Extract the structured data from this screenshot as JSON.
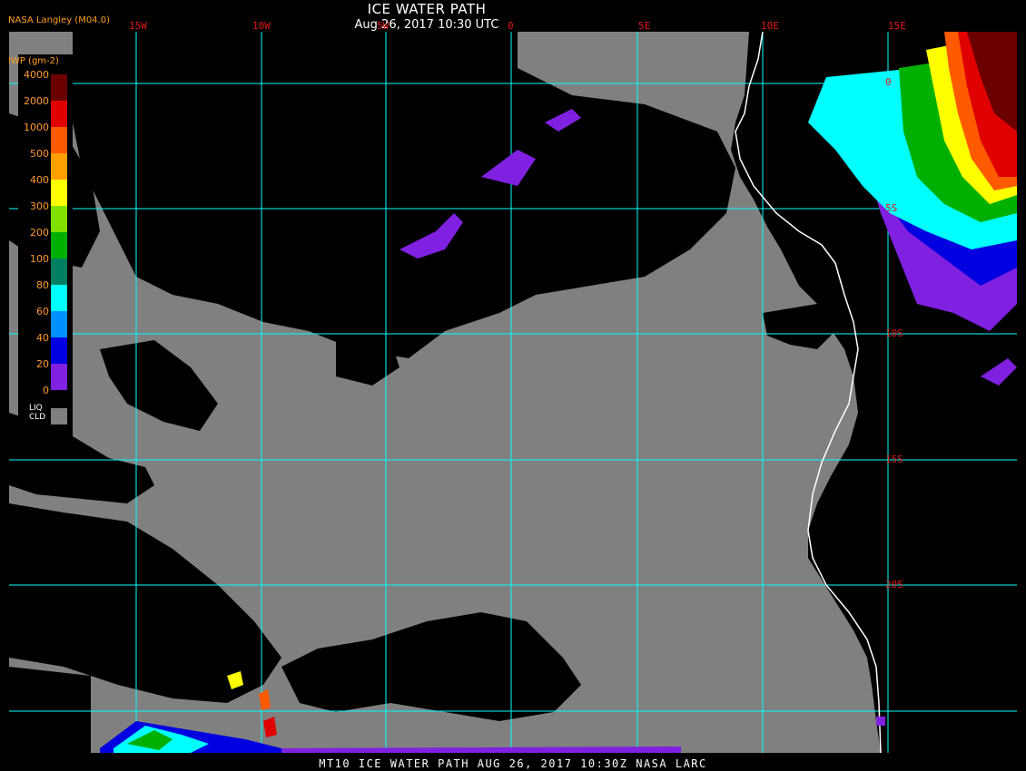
{
  "header": {
    "title": "ICE WATER PATH",
    "subtitle": "Aug 26, 2017 10:30 UTC",
    "version": "NASA Langley (M04.0)"
  },
  "footer": {
    "text": "MT10  ICE WATER PATH  AUG 26, 2017 10:30Z  NASA LARC"
  },
  "legend": {
    "title": "IWP (gm-2)",
    "labels": [
      "4000",
      "2000",
      "1000",
      "500",
      "400",
      "300",
      "200",
      "100",
      "80",
      "60",
      "40",
      "20",
      "0"
    ],
    "colors": [
      "#6b0000",
      "#e00000",
      "#ff5a00",
      "#ffa000",
      "#ffff00",
      "#80e000",
      "#00b000",
      "#008060",
      "#00ffff",
      "#0090ff",
      "#0000e0",
      "#8020e0"
    ],
    "liq_label_1": "LIQ",
    "liq_label_2": "CLD",
    "liq_color": "#808080"
  },
  "grid": {
    "lon_labels": [
      "15W",
      "10W",
      "5W",
      "0",
      "5E",
      "10E",
      "15E"
    ],
    "lat_labels": [
      "0",
      "5S",
      "10S",
      "15S",
      "20S"
    ],
    "line_color": "#00ffff"
  },
  "colors": {
    "background": "#000000",
    "clear_sky": "#000000",
    "liquid_cloud": "#808080",
    "coastline": "#ffffff"
  }
}
